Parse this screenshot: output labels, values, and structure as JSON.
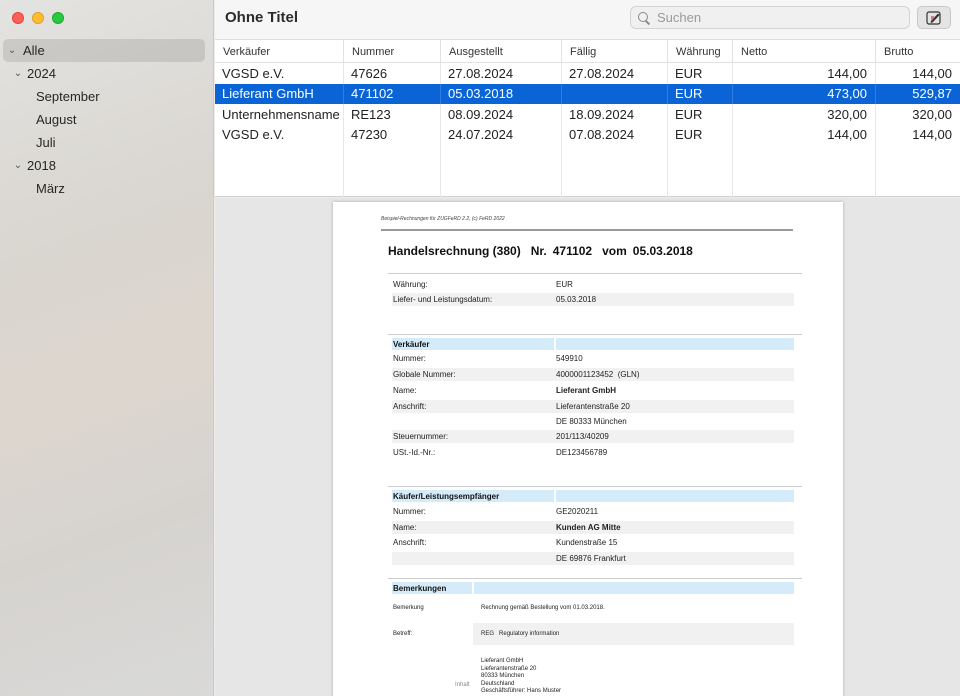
{
  "window": {
    "title": "Ohne Titel"
  },
  "search": {
    "placeholder": "Suchen"
  },
  "sidebar": {
    "items": [
      {
        "label": "Alle",
        "level": 0,
        "selected": true,
        "chevron": true
      },
      {
        "label": "2024",
        "level": 1,
        "selected": false,
        "chevron": true
      },
      {
        "label": "September",
        "level": 2
      },
      {
        "label": "August",
        "level": 2
      },
      {
        "label": "Juli",
        "level": 2
      },
      {
        "label": "2018",
        "level": 1,
        "selected": false,
        "chevron": true
      },
      {
        "label": "März",
        "level": 2
      }
    ]
  },
  "table": {
    "columns": [
      "Verkäufer",
      "Nummer",
      "Ausgestellt",
      "Fällig",
      "Währung",
      "Netto",
      "Brutto"
    ],
    "rows": [
      {
        "cells": [
          "VGSD e.V.",
          "47626",
          "27.08.2024",
          "27.08.2024",
          "EUR",
          "144,00",
          "144,00"
        ],
        "selected": false
      },
      {
        "cells": [
          "Lieferant GmbH",
          "471102",
          "05.03.2018",
          "",
          "EUR",
          "473,00",
          "529,87"
        ],
        "selected": true
      },
      {
        "cells": [
          "Unternehmensname",
          "RE123",
          "08.09.2024",
          "18.09.2024",
          "EUR",
          "320,00",
          "320,00"
        ],
        "selected": false
      },
      {
        "cells": [
          "VGSD e.V.",
          "47230",
          "24.07.2024",
          "07.08.2024",
          "EUR",
          "144,00",
          "144,00"
        ],
        "selected": false
      }
    ]
  },
  "doc": {
    "header": "Beispiel-Rechnungen für ZUGFeRD 2.2, (c) FeRD 2022",
    "title_type": "Handelsrechnung (380)",
    "title_nr_label": "Nr.",
    "title_nr": "471102",
    "title_date_label": "vom",
    "title_date": "05.03.2018",
    "currency_label": "Währung:",
    "currency": "EUR",
    "delivery_label": "Liefer- und Leistungsdatum:",
    "delivery": "05.03.2018",
    "seller": {
      "heading": "Verkäufer",
      "number_label": "Nummer:",
      "number": "549910",
      "gln_label": "Globale Nummer:",
      "gln": "4000001123452",
      "gln_suffix": "(GLN)",
      "name_label": "Name:",
      "name": "Lieferant GmbH",
      "address_label": "Anschrift:",
      "street": "Lieferantenstraße 20",
      "city": "DE 80333 München",
      "tax_label": "Steuernummer:",
      "tax": "201/113/40209",
      "vat_label": "USt.-Id.-Nr.:",
      "vat": "DE123456789"
    },
    "buyer": {
      "heading": "Käufer/Leistungsempfänger",
      "number_label": "Nummer:",
      "number": "GE2020211",
      "name_label": "Name:",
      "name": "Kunden AG Mitte",
      "address_label": "Anschrift:",
      "street": "Kundenstraße 15",
      "city": "DE 69876 Frankfurt"
    },
    "remarks": {
      "heading": "Bemerkungen",
      "remark_label": "Bemerkung",
      "remark": "Rechnung gemäß Bestellung vom 01.03.2018.",
      "subject_label": "Betreff:",
      "subject_code": "REG",
      "subject": "Regulatory information",
      "content_label": "Inhalt",
      "address_lines": [
        "Lieferant GmbH",
        "Lieferantenstraße 20",
        "80333 München",
        "Deutschland",
        "Geschäftsführer: Hans Muster"
      ]
    }
  },
  "colors": {
    "selection": "#0a64d6",
    "section_head": "#d4ecfa"
  }
}
